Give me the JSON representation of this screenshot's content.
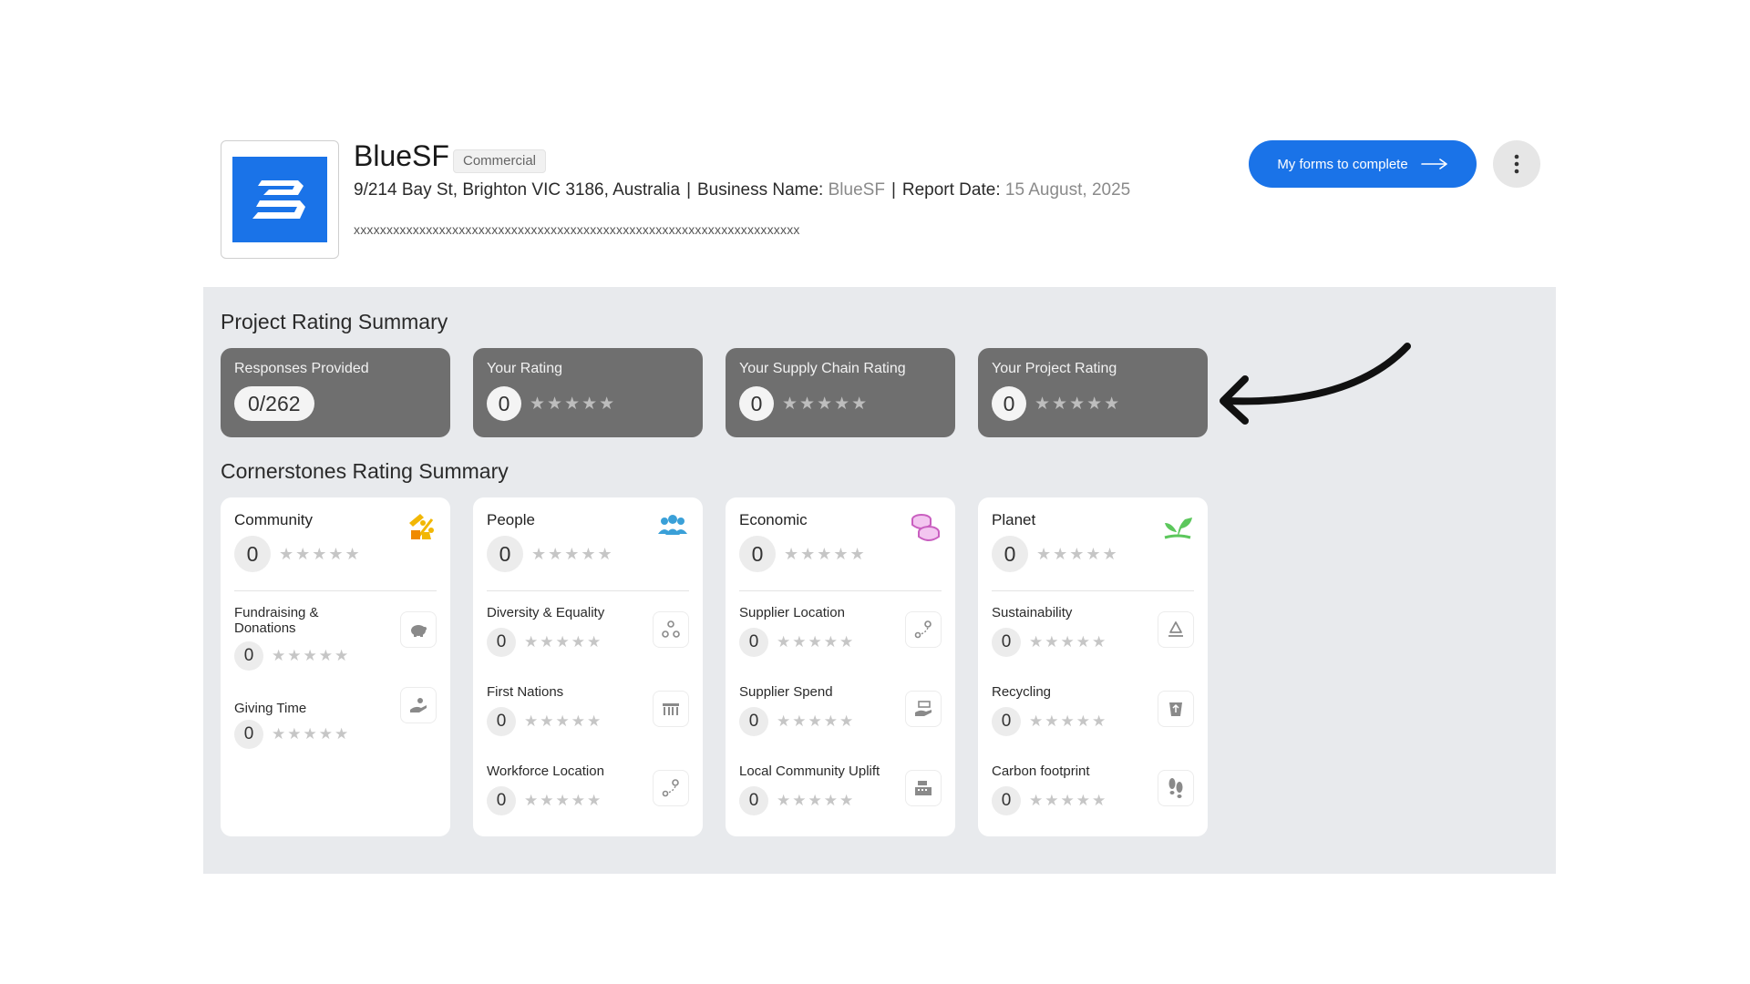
{
  "header": {
    "company_name": "BlueSF",
    "badge": "Commercial",
    "address": "9/214 Bay St, Brighton VIC 3186, Australia",
    "business_name_label": "Business Name:",
    "business_name_value": "BlueSF",
    "report_date_label": "Report Date:",
    "report_date_value": "15 August, 2025",
    "separator": "|",
    "description": "xxxxxxxxxxxxxxxxxxxxxxxxxxxxxxxxxxxxxxxxxxxxxxxxxxxxxxxxxxxxxxxxxxxx",
    "forms_button_label": "My forms to complete",
    "colors": {
      "accent": "#1a73e8"
    }
  },
  "project_summary": {
    "title": "Project Rating Summary",
    "cards": [
      {
        "label": "Responses Provided",
        "value": "0/262",
        "stars": ""
      },
      {
        "label": "Your Rating",
        "value": "0",
        "stars": "★★★★★"
      },
      {
        "label": "Your Supply Chain Rating",
        "value": "0",
        "stars": "★★★★★"
      },
      {
        "label": "Your Project Rating",
        "value": "0",
        "stars": "★★★★★"
      }
    ]
  },
  "cornerstones": {
    "title": "Cornerstones Rating Summary",
    "cards": [
      {
        "title": "Community",
        "icon": "community-icon",
        "value": "0",
        "stars": "★★★★★",
        "items": [
          {
            "label": "Fundraising & Donations",
            "icon": "piggy-bank-icon",
            "value": "0",
            "stars": "★★★★★"
          },
          {
            "label": "Giving Time",
            "icon": "giving-hand-icon",
            "value": "0",
            "stars": "★★★★★"
          }
        ]
      },
      {
        "title": "People",
        "icon": "people-icon",
        "value": "0",
        "stars": "★★★★★",
        "items": [
          {
            "label": "Diversity & Equality",
            "icon": "diversity-icon",
            "value": "0",
            "stars": "★★★★★"
          },
          {
            "label": "First Nations",
            "icon": "first-nations-icon",
            "value": "0",
            "stars": "★★★★★"
          },
          {
            "label": "Workforce Location",
            "icon": "location-route-icon",
            "value": "0",
            "stars": "★★★★★"
          }
        ]
      },
      {
        "title": "Economic",
        "icon": "coins-icon",
        "value": "0",
        "stars": "★★★★★",
        "items": [
          {
            "label": "Supplier Location",
            "icon": "location-route-icon",
            "value": "0",
            "stars": "★★★★★"
          },
          {
            "label": "Supplier Spend",
            "icon": "money-hand-icon",
            "value": "0",
            "stars": "★★★★★"
          },
          {
            "label": "Local Community Uplift",
            "icon": "cash-register-icon",
            "value": "0",
            "stars": "★★★★★"
          }
        ]
      },
      {
        "title": "Planet",
        "icon": "sprout-icon",
        "value": "0",
        "stars": "★★★★★",
        "items": [
          {
            "label": "Sustainability",
            "icon": "recycle-icon",
            "value": "0",
            "stars": "★★★★★"
          },
          {
            "label": "Recycling",
            "icon": "recycle-bin-icon",
            "value": "0",
            "stars": "★★★★★"
          },
          {
            "label": "Carbon footprint",
            "icon": "footprint-icon",
            "value": "0",
            "stars": "★★★★★"
          }
        ]
      }
    ]
  }
}
